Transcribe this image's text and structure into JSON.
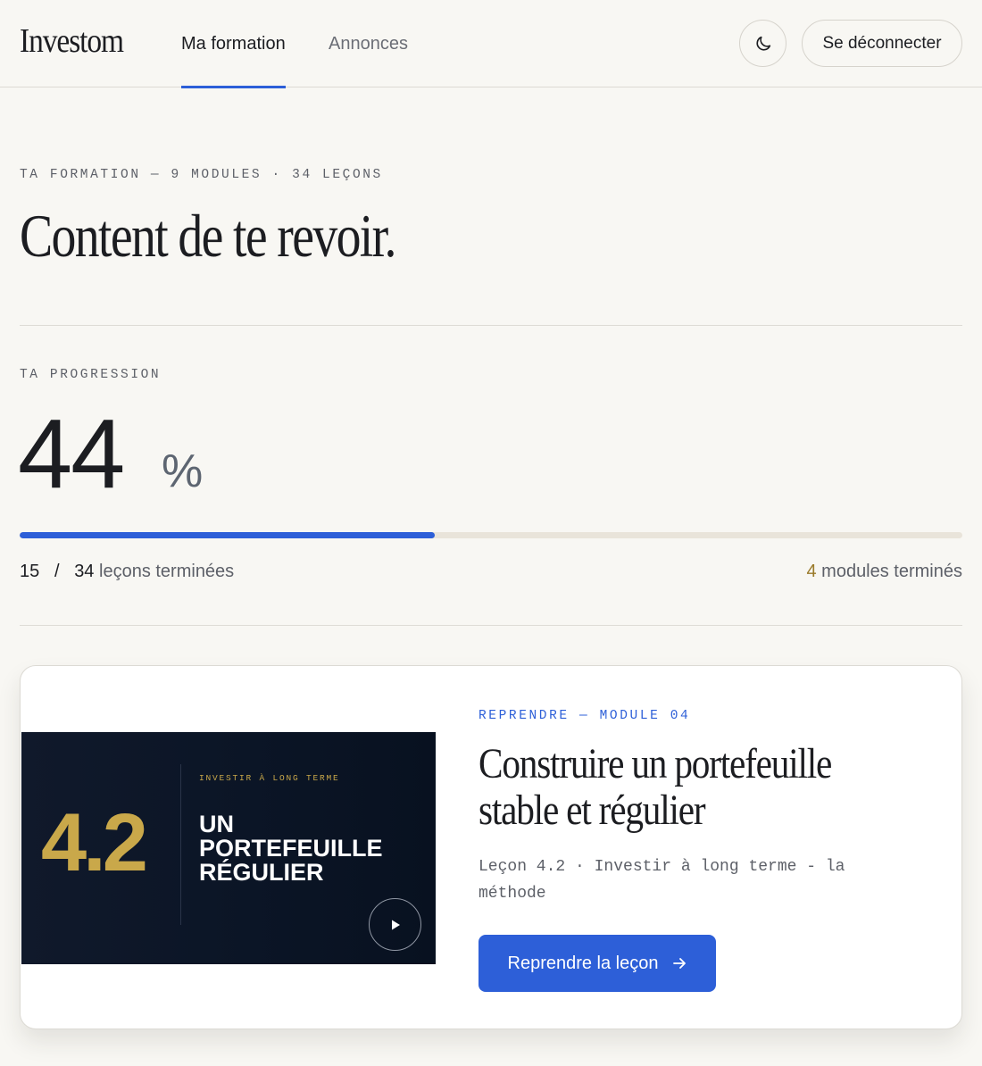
{
  "header": {
    "logo": "Investom",
    "tabs": [
      {
        "label": "Ma formation",
        "active": true
      },
      {
        "label": "Annonces",
        "active": false
      }
    ],
    "theme_toggle_icon": "moon-icon",
    "logout_label": "Se déconnecter"
  },
  "intro": {
    "eyebrow": "TA FORMATION — 9 MODULES · 34 LEÇONS",
    "headline": "Content de te revoir."
  },
  "progress": {
    "eyebrow": "TA PROGRESSION",
    "percent": "44",
    "percent_sign": "%",
    "fraction": 0.44,
    "lessons_done": "15",
    "separator": "/",
    "lessons_total": "34",
    "lessons_suffix": "leçons terminées",
    "modules_done": "4",
    "modules_suffix": "modules terminés"
  },
  "resume_card": {
    "thumbnail": {
      "number": "4.2",
      "eyebrow": "INVESTIR À LONG TERME",
      "title": "UN\nPORTEFEUILLE\nRÉGULIER",
      "play_icon": "play-icon"
    },
    "eyebrow": "REPRENDRE — MODULE 04",
    "title": "Construire un portefeuille stable et régulier",
    "description": "Leçon 4.2 · Investir à long terme - la méthode",
    "button_label": "Reprendre la leçon",
    "button_icon": "arrow-right-icon"
  },
  "colors": {
    "background": "#f8f7f3",
    "accent": "#2d5fd8",
    "gold": "#c9a84a",
    "thumbnail_bg": "#0b1526",
    "track": "#e9e4da"
  }
}
